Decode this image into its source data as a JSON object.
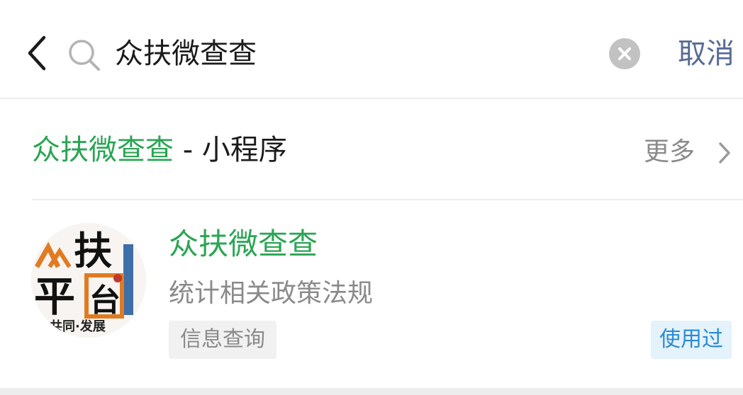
{
  "search": {
    "query": "众扶微查查",
    "cancel_label": "取消"
  },
  "section": {
    "keyword": "众扶微查查",
    "suffix": " - 小程序",
    "more_label": "更多"
  },
  "result": {
    "name": "众扶微查查",
    "description": "统计相关政策法规",
    "category": "信息查询",
    "used_badge": "使用过",
    "logo": {
      "top_left": "众",
      "top_right": "扶",
      "bottom_left": "平",
      "bottom_right": "台",
      "footer": "共同·发展"
    }
  },
  "colors": {
    "accent_green": "#2aa553",
    "link_blue": "#576b95",
    "badge_blue": "#2a8bd2",
    "badge_bg": "#e3f2fb",
    "muted_gray": "#8a8a8a"
  },
  "icons": {
    "back": "chevron-left-icon",
    "search": "search-icon",
    "clear": "clear-circle-icon",
    "more": "chevron-right-icon"
  }
}
